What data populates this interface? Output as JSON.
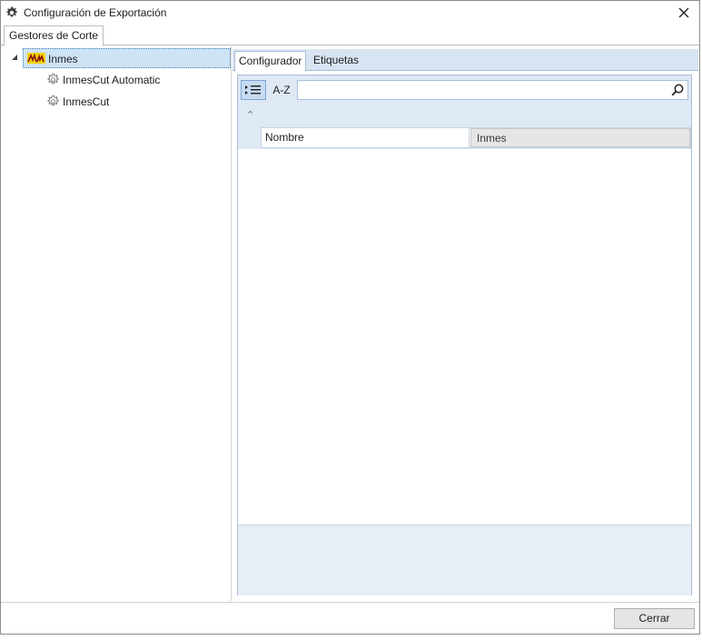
{
  "window": {
    "title": "Configuración de Exportación",
    "icon": "gear-icon"
  },
  "top_tabs": [
    {
      "label": "Gestores de Corte",
      "active": true
    }
  ],
  "tree": {
    "root": {
      "label": "Inmes",
      "icon": "inmes-logo-icon",
      "expanded": true,
      "selected": true
    },
    "children": [
      {
        "label": "InmesCut Automatic",
        "icon": "gear-icon"
      },
      {
        "label": "InmesCut",
        "icon": "gear-icon"
      }
    ]
  },
  "inner_tabs": [
    {
      "label": "Configurador",
      "active": true
    },
    {
      "label": "Etiquetas",
      "active": false
    }
  ],
  "property_grid": {
    "categorized_icon": "categorized-icon",
    "alphabetical_label": "A-Z",
    "search_placeholder": "",
    "rows": [
      {
        "name": "Nombre",
        "value": "Inmes"
      }
    ]
  },
  "footer": {
    "close_label": "Cerrar"
  },
  "colors": {
    "selection": "#cfe3f6",
    "tab_strip": "#d9e4f2",
    "grid_band": "#dfe9f5"
  }
}
